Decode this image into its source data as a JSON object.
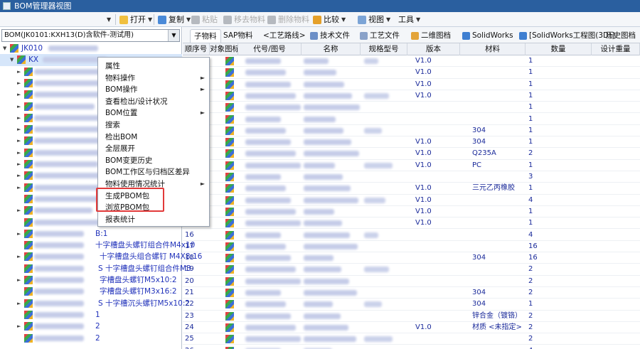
{
  "window": {
    "title": "BOM管理器视图"
  },
  "toolbar": {
    "open": "打开",
    "copy": "复制",
    "paste": "粘贴",
    "move_material": "移去物料",
    "delete_material": "删除物料",
    "compare": "比较",
    "view": "视图",
    "tools": "工具"
  },
  "bom_selector": {
    "value": "BOM(JK0101:KXH13(D)含软件-测试用)"
  },
  "tree": {
    "root_label": "JK010",
    "child_label": "KX",
    "visible_labels": [
      "B:1",
      "十字槽盘头螺钉组合件M4x10",
      "十字槽盘头组合螺钉 M4X8:16",
      "S 十字槽盘头螺钉组合件M3",
      "字槽盘头螺钉M5x10:2",
      "字槽盘头螺钉M3x16:2",
      "S 十字槽沉头螺钉M5x10:2",
      "1",
      "2",
      "2"
    ]
  },
  "context_menu": {
    "items": [
      {
        "label": "属性",
        "submenu": false
      },
      {
        "label": "物料操作",
        "submenu": true
      },
      {
        "label": "BOM操作",
        "submenu": true
      },
      {
        "label": "查看检出/设计状况",
        "submenu": false
      },
      {
        "label": "BOM位置",
        "submenu": true
      },
      {
        "label": "搜索",
        "submenu": false
      },
      {
        "label": "检出BOM",
        "submenu": false
      },
      {
        "label": "全层展开",
        "submenu": false
      },
      {
        "label": "BOM变更历史",
        "submenu": false
      },
      {
        "label": "BOM工作区与归档区差异",
        "submenu": false
      },
      {
        "label": "物料使用情况统计",
        "submenu": true
      },
      {
        "label": "生成PBOM包",
        "submenu": false
      },
      {
        "label": "浏览PBOM包",
        "submenu": false
      },
      {
        "label": "报表统计",
        "submenu": false
      }
    ]
  },
  "tabs": [
    "子物料",
    "SAP物料",
    "<工艺路线>",
    "技术文件",
    "工艺文件",
    "二维图档",
    "SolidWorks",
    "[SolidWorks工程图(3D)]",
    "历史图档"
  ],
  "grid": {
    "columns": [
      "顺序号",
      "对象图标",
      "代号/图号",
      "名称",
      "规格型号",
      "版本",
      "材料",
      "数量",
      "设计重量"
    ],
    "rows": [
      {
        "seq": "",
        "version": "V1.0",
        "material": "",
        "qty": "1"
      },
      {
        "seq": "",
        "version": "V1.0",
        "material": "",
        "qty": "1"
      },
      {
        "seq": "",
        "version": "V1.0",
        "material": "",
        "qty": "1"
      },
      {
        "seq": "",
        "version": "V1.0",
        "material": "",
        "qty": "1"
      },
      {
        "seq": "",
        "version": "",
        "material": "",
        "qty": "1"
      },
      {
        "seq": "",
        "version": "",
        "material": "",
        "qty": "1"
      },
      {
        "seq": "",
        "version": "",
        "material": "304",
        "qty": "1"
      },
      {
        "seq": "",
        "version": "V1.0",
        "material": "304",
        "qty": "1"
      },
      {
        "seq": "",
        "version": "V1.0",
        "material": "Q235A",
        "qty": "2"
      },
      {
        "seq": "",
        "version": "V1.0",
        "material": "PC",
        "qty": "1"
      },
      {
        "seq": "",
        "version": "",
        "material": "",
        "qty": "3"
      },
      {
        "seq": "",
        "version": "V1.0",
        "material": "三元乙丙橡胶",
        "qty": "1"
      },
      {
        "seq": "",
        "version": "V1.0",
        "material": "",
        "qty": "4"
      },
      {
        "seq": "",
        "version": "V1.0",
        "material": "",
        "qty": "1"
      },
      {
        "seq": "",
        "version": "V1.0",
        "material": "",
        "qty": "1"
      },
      {
        "seq": "16",
        "version": "",
        "material": "",
        "qty": "4"
      },
      {
        "seq": "17",
        "version": "",
        "material": "",
        "qty": "16"
      },
      {
        "seq": "18",
        "version": "",
        "material": "304",
        "qty": "16"
      },
      {
        "seq": "19",
        "version": "",
        "material": "",
        "qty": "2"
      },
      {
        "seq": "20",
        "version": "",
        "material": "",
        "qty": "2"
      },
      {
        "seq": "21",
        "version": "",
        "material": "304",
        "qty": "2"
      },
      {
        "seq": "22",
        "version": "",
        "material": "304",
        "qty": "1"
      },
      {
        "seq": "23",
        "version": "",
        "material": "锌合金（镀铬）",
        "qty": "2"
      },
      {
        "seq": "24",
        "version": "V1.0",
        "material": "材质 <未指定>",
        "qty": "2"
      },
      {
        "seq": "25",
        "version": "",
        "material": "",
        "qty": "2"
      },
      {
        "seq": "26",
        "version": "",
        "material": "",
        "qty": "4"
      }
    ]
  }
}
